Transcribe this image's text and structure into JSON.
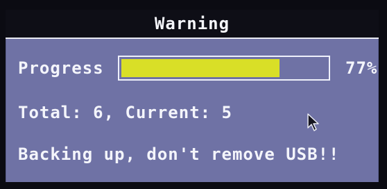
{
  "dialog": {
    "title": "Warning"
  },
  "progress": {
    "label": "Progress",
    "percent_text": "77%",
    "value_fraction": 0.77,
    "fill_color": "#d9df27"
  },
  "status": {
    "total_current_text": "Total: 6, Current: 5",
    "message": "Backing up, don't remove USB!!"
  },
  "colors": {
    "panel_bg": "#6f72a5",
    "title_bg": "#0e0e16",
    "text": "#f4f5fb"
  },
  "icons": {
    "cursor": "mouse-pointer-icon"
  }
}
